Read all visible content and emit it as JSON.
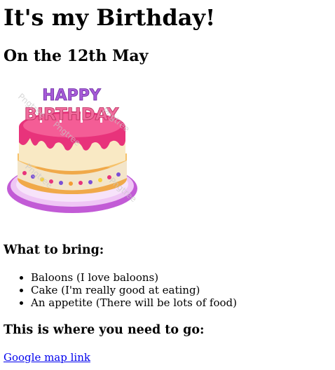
{
  "heading": "It's my Birthday!",
  "subheading": "On the 12th May",
  "image": {
    "icon": "birthday-cake-icon",
    "topper_text": [
      "HAPPY",
      "BIRTHDAY"
    ],
    "watermark": "Pngtree"
  },
  "bring": {
    "title": "What to bring:",
    "items": [
      "Baloons (I love baloons)",
      "Cake (I'm really good at eating)",
      "An appetite (There will be lots of food)"
    ]
  },
  "location": {
    "title": "This is where you need to go:",
    "link_text": "Google map link"
  },
  "colors": {
    "link": "#0000ee",
    "cake_pink": "#e8337b",
    "plate_purple": "#c25bd6"
  }
}
